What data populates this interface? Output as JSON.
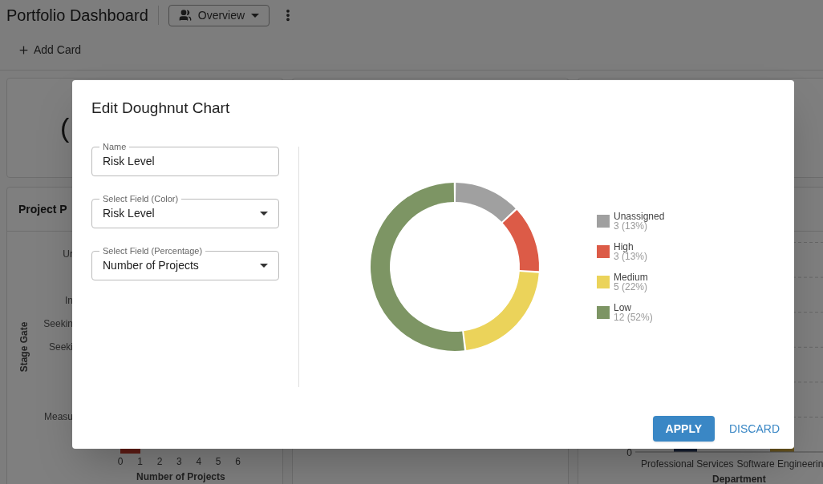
{
  "header": {
    "title": "Portfolio Dashboard",
    "view_button": "Overview"
  },
  "toolbar": {
    "add_button": "Add Card"
  },
  "cards": {
    "kpi_partial": "(",
    "pipeline": {
      "title": "Project P",
      "y_axis_title": "Stage Gate",
      "y_labels": [
        "Ur",
        "In",
        "Seekin",
        "Seeki",
        "Measu"
      ],
      "x_ticks": [
        "0",
        "1",
        "2",
        "3",
        "4",
        "5",
        "6"
      ],
      "x_axis_title": "Number of Projects"
    },
    "department": {
      "y_tick": "0",
      "x_labels": [
        "Professional Services",
        "Software Engineerin"
      ],
      "x_axis_title": "Department"
    }
  },
  "modal": {
    "title": "Edit Doughnut Chart",
    "fields": [
      {
        "kind": "text",
        "label": "Name",
        "value": "Risk Level"
      },
      {
        "kind": "select",
        "label": "Select Field (Color)",
        "value": "Risk Level"
      },
      {
        "kind": "select",
        "label": "Select Field (Percentage)",
        "value": "Number of Projects"
      }
    ],
    "preview": {
      "chart_data": {
        "type": "donut",
        "categories": [
          "Unassigned",
          "High",
          "Medium",
          "Low"
        ],
        "series": [
          {
            "values": [
              13,
              13,
              22,
              52
            ]
          }
        ]
      },
      "legend": [
        {
          "value": "3 (13%)",
          "color": "#a0a0a0"
        },
        {
          "value": "3 (13%)",
          "color": "#dc5b47"
        },
        {
          "value": "5 (22%)",
          "color": "#ebd35a"
        },
        {
          "value": "12 (52%)",
          "color": "#7d9564"
        }
      ]
    },
    "buttons": [
      {
        "kind": "primary",
        "label": "APPLY"
      },
      {
        "kind": "text",
        "label": "DISCARD"
      }
    ]
  }
}
